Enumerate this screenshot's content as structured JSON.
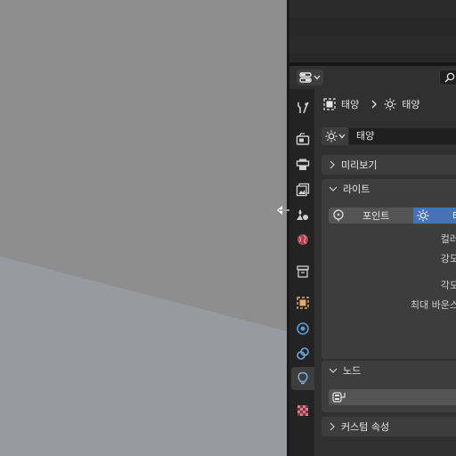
{
  "breadcrumb": {
    "object_name": "태양",
    "light_name": "태양"
  },
  "datablock": {
    "name": "태양"
  },
  "panels": {
    "preview": {
      "title": "미리보기"
    },
    "light": {
      "title": "라이트",
      "types": {
        "point": "포인트",
        "sun": "태"
      },
      "labels": {
        "color": "컬러",
        "strength": "강도",
        "angle": "각도",
        "max_bounces": "최대 바운스"
      }
    },
    "nodes": {
      "title": "노드"
    },
    "custom_props": {
      "title": "커스텀 속성"
    }
  },
  "tabs": [
    "tool-tab",
    "render-tab",
    "output-tab",
    "view-layer-tab",
    "scene-tab",
    "world-tab",
    "collection-tab",
    "object-tab",
    "physics-tab",
    "constraints-tab",
    "data-tab",
    "texture-tab"
  ],
  "colors": {
    "accent": "#4772b3",
    "panel_bg": "#3d3d3d",
    "editor_bg": "#303030",
    "viewport_top": "#8e8e8e",
    "viewport_floor": "#989a9f"
  }
}
